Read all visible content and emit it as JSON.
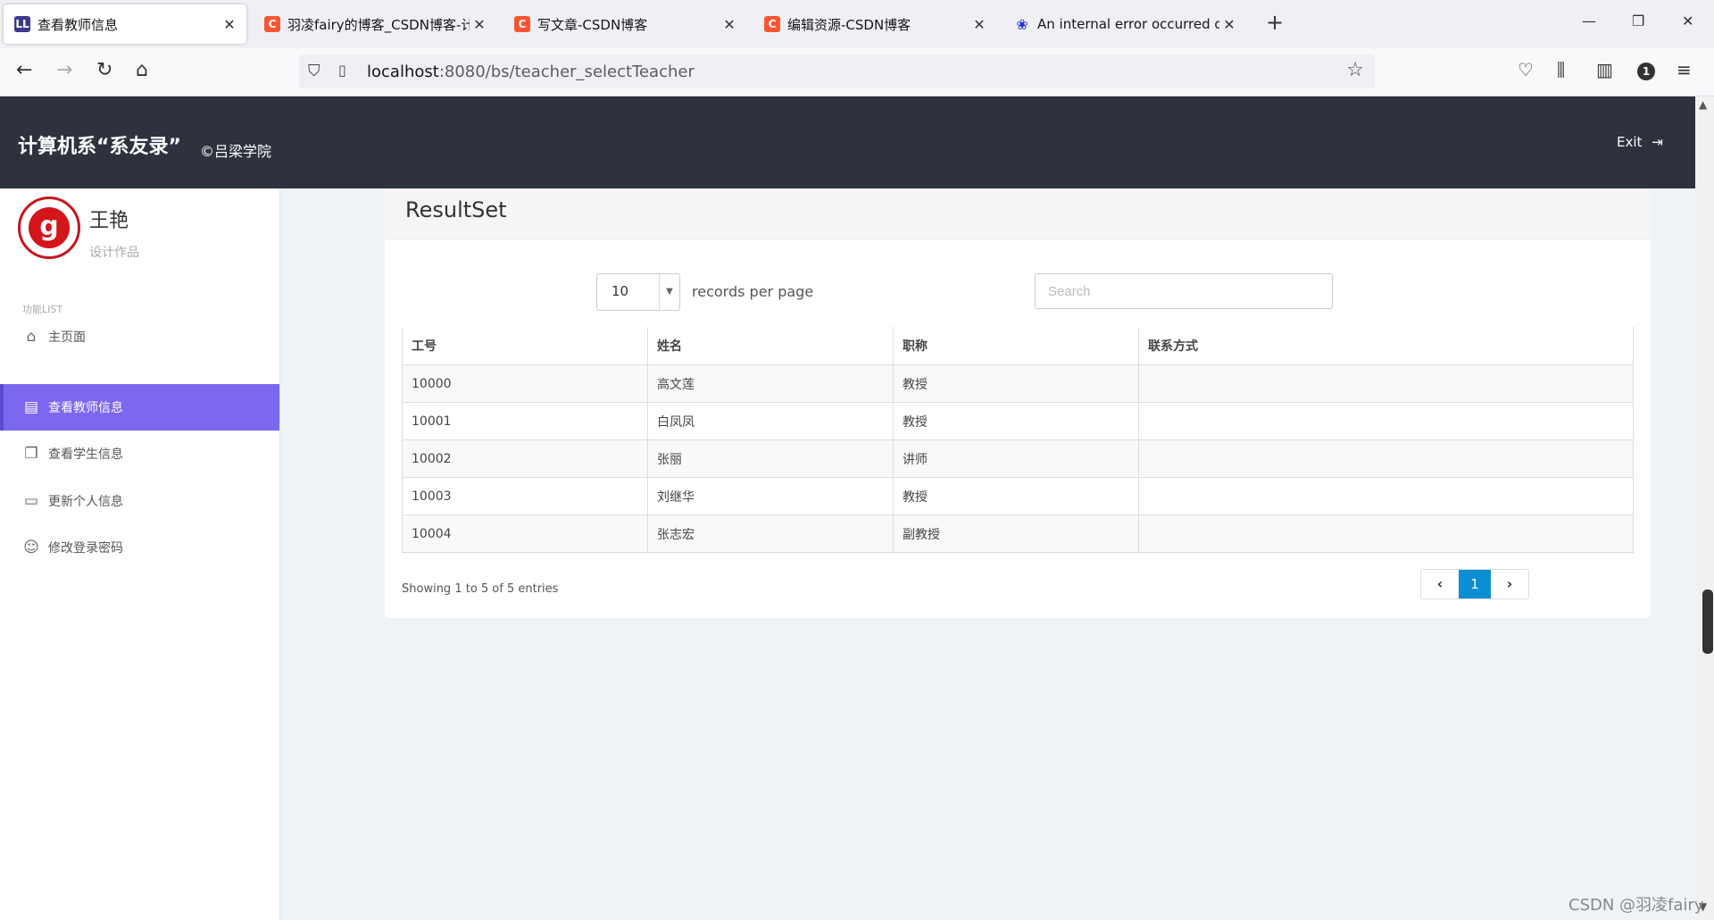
{
  "browser": {
    "tabs": [
      {
        "title": "查看教师信息",
        "favicon": "LL",
        "favicon_color": "#3a3a8c",
        "active": true
      },
      {
        "title": "羽凌fairy的博客_CSDN博客-计",
        "favicon": "C",
        "favicon_color": "#fc5531"
      },
      {
        "title": "写文章-CSDN博客",
        "favicon": "C",
        "favicon_color": "#fc5531"
      },
      {
        "title": "编辑资源-CSDN博客",
        "favicon": "C",
        "favicon_color": "#fc5531"
      },
      {
        "title": "An internal error occurred du",
        "favicon": "paw",
        "favicon_color": "#2932e1"
      }
    ],
    "url_host": "localhost",
    "url_rest": ":8080/bs/teacher_selectTeacher"
  },
  "header": {
    "brand": "计算机系“系友录”",
    "subtitle": "©吕梁学院",
    "exit_label": "Exit"
  },
  "sidebar": {
    "user_name": "王艳",
    "user_role": "设计作品",
    "section_label": "功能LIST",
    "items": [
      {
        "label": "主页面",
        "icon": "home-icon"
      },
      {
        "label": "查看教师信息",
        "icon": "building-icon",
        "active": true
      },
      {
        "label": "查看学生信息",
        "icon": "copy-icon"
      },
      {
        "label": "更新个人信息",
        "icon": "idcard-icon"
      },
      {
        "label": "修改登录密码",
        "icon": "user-icon"
      }
    ]
  },
  "main": {
    "title": "ResultSet",
    "page_length": "10",
    "records_label": "records per page",
    "search_placeholder": "Search",
    "columns": [
      "工号",
      "姓名",
      "职称",
      "联系方式"
    ],
    "rows": [
      [
        "10000",
        "高文莲",
        "教授",
        ""
      ],
      [
        "10001",
        "白凤凤",
        "教授",
        ""
      ],
      [
        "10002",
        "张丽",
        "讲师",
        ""
      ],
      [
        "10003",
        "刘继华",
        "教授",
        ""
      ],
      [
        "10004",
        "张志宏",
        "副教授",
        ""
      ]
    ],
    "info": "Showing 1 to 5 of 5 entries",
    "current_page": "1"
  },
  "watermark": "CSDN @羽凌fairy"
}
